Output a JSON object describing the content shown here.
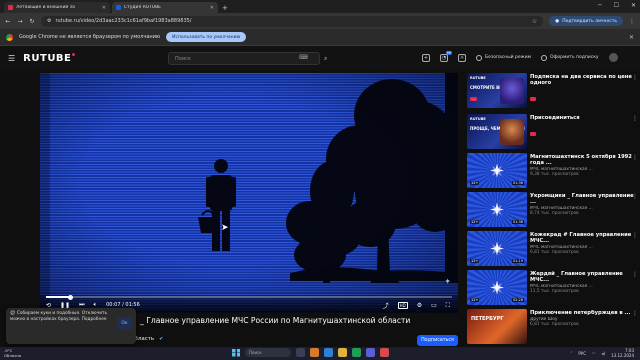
{
  "browser": {
    "tabs": [
      {
        "title": "Летающие и внешний за",
        "active": false
      },
      {
        "title": "Студия RUTUBE",
        "active": true
      }
    ],
    "url": "rutube.ru/video/2d3aac233c1c61af9baf1983a889835/",
    "update_label": "Подтвердить личность"
  },
  "infobar": {
    "text": "Google Chrome не является браузером по умолчанию",
    "button": "Использовать по умолчанию"
  },
  "header": {
    "logo": "RUTUBE",
    "search_placeholder": "Поиск",
    "notif_count": "99",
    "safe_mode": "Безопасный режим",
    "subscribe_plan": "Оформить подписку"
  },
  "player": {
    "time": "00:07 / 01:56",
    "progress": 0.06,
    "quality": "HD"
  },
  "video": {
    "title": "_ Главное управление МЧС России по Магнитушахтинской области",
    "channel": "МЧС магнитошахтинская область",
    "subscribe_label": "Подписаться"
  },
  "cookie": {
    "text": "Собираем куки и подобные. Отключить можно в настройках браузера. Подробнее",
    "link": "Подробнее",
    "ok": "Ок"
  },
  "sidebar": {
    "items": [
      {
        "title": "Подписка на два сервиса по цене одного",
        "channel": "",
        "views": "",
        "duration": "",
        "kind": "promo",
        "thumb_logo": "RUTUBE",
        "thumb_text": "СМОТРИТЕ ВМЕСТЕ",
        "thumb_badge": "..."
      },
      {
        "title": "Присоединиться",
        "channel": "",
        "views": "",
        "duration": "",
        "kind": "promo2",
        "thumb_logo": "RUTUBE",
        "thumb_text": "ПРОЩЕ, ЧЕМ КАЖЕТСЯ",
        "thumb_badge": ""
      },
      {
        "title": "Магнитошахтинск 5 октября 1992 года ...",
        "channel": "МЧС магнитошахтинская ...",
        "views": "9,38 тыс. просмотров",
        "duration": "01:36",
        "age": "12+",
        "kind": "mchs"
      },
      {
        "title": "Укромщики _ Главное управление ...",
        "channel": "МЧС магнитошахтинская ...",
        "views": "8,74 тыс. просмотров",
        "duration": "01:38",
        "age": "12+",
        "kind": "mchs"
      },
      {
        "title": "Кожекрад # Главное управление МЧС...",
        "channel": "МЧС магнитошахтинская ...",
        "views": "6,81 тыс. просмотров",
        "duration": "01:19",
        "age": "12+",
        "kind": "mchs"
      },
      {
        "title": "Жердяй _ Главное управление МЧС...",
        "channel": "МЧС магнитошахтинская ...",
        "views": "11,5 тыс. просмотров",
        "duration": "02:28",
        "age": "12+",
        "kind": "mchs"
      },
      {
        "title": "Приключение петербуржцев в ...",
        "channel": "Другие Шоу",
        "views": "6,81 тыс. просмотров",
        "duration": "",
        "age": "",
        "kind": "fire",
        "thumb_text": "ПЕТЕРБУРГ"
      }
    ]
  },
  "taskbar": {
    "weather_temp": "-9°C",
    "weather_desc": "Облачно",
    "search": "Поиск",
    "lang": "РУС",
    "time": "7:03",
    "date": "13.12.2024"
  },
  "colors": {
    "accent": "#1a5cff",
    "brand_red": "#e02a4e",
    "video_blue": "#1f47c8"
  }
}
